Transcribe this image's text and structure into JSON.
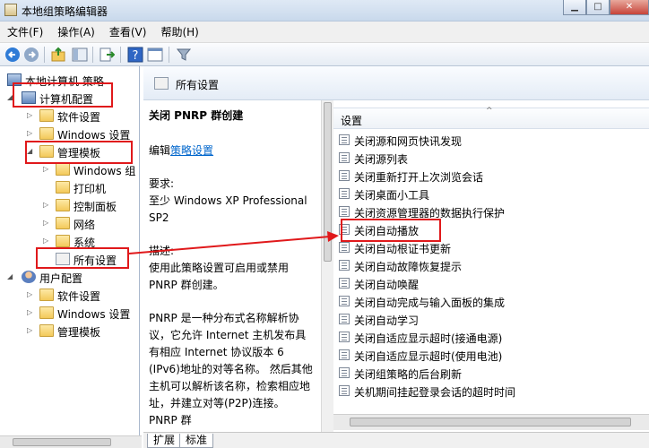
{
  "window": {
    "title": "本地组策略编辑器"
  },
  "menu": [
    "文件(F)",
    "操作(A)",
    "查看(V)",
    "帮助(H)"
  ],
  "tree": {
    "root": "本地计算机 策略",
    "computer_config": "计算机配置",
    "software_settings": "软件设置",
    "windows_settings": "Windows 设置",
    "admin_templates": "管理模板",
    "windows_components": "Windows 组",
    "printers": "打印机",
    "control_panel": "控制面板",
    "network": "网络",
    "system": "系统",
    "all_settings": "所有设置",
    "user_config": "用户配置",
    "user_software_settings": "软件设置",
    "user_windows_settings": "Windows 设置",
    "user_admin_templates": "管理模板"
  },
  "right_header": {
    "title": "所有设置"
  },
  "description": {
    "title": "关闭 PNRP 群创建",
    "edit_prefix": "编辑",
    "edit_link": "策略设置",
    "requirements_label": "要求:",
    "requirements_text": "至少 Windows XP Professional SP2",
    "desc_label": "描述:",
    "desc_text": "使用此策略设置可启用或禁用 PNRP 群创建。",
    "desc_para2": "PNRP 是一种分布式名称解析协议，它允许 Internet 主机发布具有相应 Internet 协议版本 6 (IPv6)地址的对等名称。 然后其他主机可以解析该名称，检索相应地址，并建立对等(P2P)连接。 PNRP 群"
  },
  "list": {
    "header": "设置",
    "items": [
      "关闭源和网页快讯发现",
      "关闭源列表",
      "关闭重新打开上次浏览会话",
      "关闭桌面小工具",
      "关闭资源管理器的数据执行保护",
      "关闭自动播放",
      "关闭自动根证书更新",
      "关闭自动故障恢复提示",
      "关闭自动唤醒",
      "关闭自动完成与输入面板的集成",
      "关闭自动学习",
      "关闭自适应显示超时(接通电源)",
      "关闭自适应显示超时(使用电池)",
      "关闭组策略的后台刷新",
      "关机期间挂起登录会话的超时时间"
    ]
  },
  "tabs": [
    "扩展",
    "标准"
  ],
  "colors": {
    "annotation": "#e0191b",
    "link": "#0066cc"
  }
}
